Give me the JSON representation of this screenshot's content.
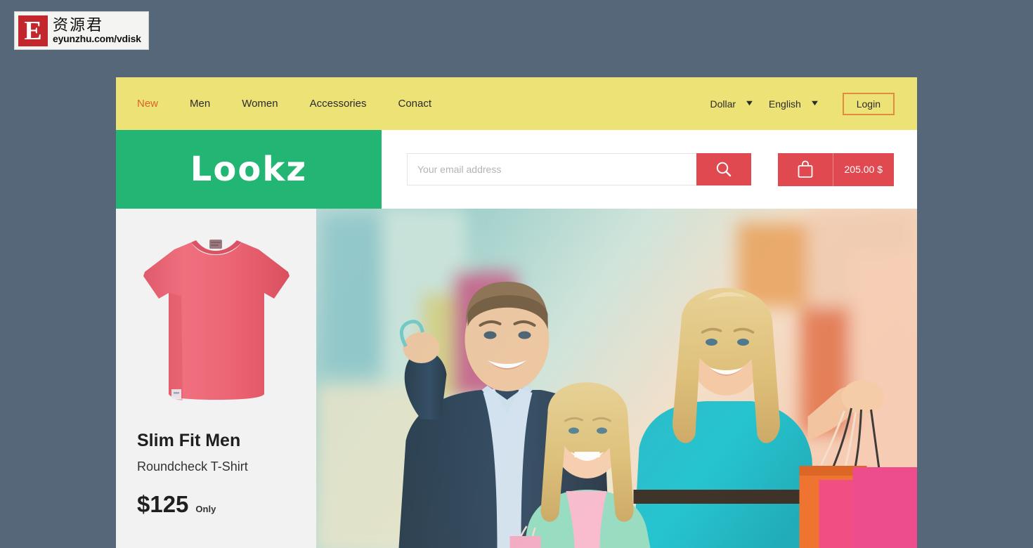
{
  "watermark": {
    "letter": "E",
    "chinese": "资源君",
    "url": "eyunzhu.com/vdisk"
  },
  "topnav": {
    "links": [
      {
        "label": "New",
        "active": true
      },
      {
        "label": "Men",
        "active": false
      },
      {
        "label": "Women",
        "active": false
      },
      {
        "label": "Accessories",
        "active": false
      },
      {
        "label": "Conact",
        "active": false
      }
    ],
    "currency_selector": {
      "value": "Dollar",
      "icon": "chevron-down-icon"
    },
    "language_selector": {
      "value": "English",
      "icon": "chevron-down-icon"
    },
    "login_label": "Login"
  },
  "brand": {
    "name_first": "L",
    "name_rest": "ookz",
    "full_name": "Lookz"
  },
  "search": {
    "placeholder": "Your email address",
    "value": "",
    "button_icon": "search-icon"
  },
  "cart": {
    "icon": "shopping-bag-icon",
    "total": "205.00 $"
  },
  "product": {
    "image_alt": "pink-tshirt",
    "title": "Slim Fit Men",
    "subtitle": "Roundcheck T-Shirt",
    "price": "$125",
    "price_note": "Only"
  },
  "hero": {
    "alt": "family-shopping-banner"
  },
  "colors": {
    "page_background": "#56677a",
    "nav_background": "#ece275",
    "nav_active_link": "#d9642a",
    "brand_green": "#22b573",
    "accent_red": "#e0494f",
    "login_border": "#e08b3d",
    "product_panel": "#f2f2f2"
  }
}
